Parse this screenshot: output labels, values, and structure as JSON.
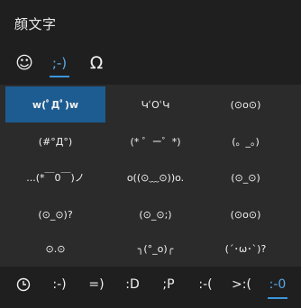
{
  "window": {
    "title": "顔文字"
  },
  "tabs": [
    {
      "label": "☺",
      "icon": "smiley-icon"
    },
    {
      "label": ";-)",
      "icon": "kaomoji"
    },
    {
      "label": "Ω",
      "icon": "omega-icon"
    }
  ],
  "grid": [
    [
      "w(ﾟДﾟ)w",
      "ԿՙOՙԿ",
      "(⊙o⊙)"
    ],
    [
      "(#°Д°)",
      "(* ゜ー゜*)",
      "(。_。)"
    ],
    [
      "...(*￣0￣)ノ",
      "o((⊙﹏⊙))o.",
      "(⊙_⊙)"
    ],
    [
      "(⊙_⊙)?",
      "(⊙_⊙;)",
      "(⊙o⊙)"
    ],
    [
      "⊙.⊙",
      "╮(°_o)╭",
      "(´･ω･`)?"
    ]
  ],
  "bottom_tabs": [
    {
      "label": "",
      "icon": "clock-icon"
    },
    {
      "label": ":-)"
    },
    {
      "label": "=)"
    },
    {
      "label": ":D"
    },
    {
      "label": ";P"
    },
    {
      "label": ":-("
    },
    {
      "label": ">:("
    },
    {
      "label": ":-0"
    }
  ],
  "colors": {
    "accent": "#3a96dd",
    "selected_cell": "#1d5c91",
    "background": "#1f1f1f",
    "grid_background": "#2b2b2b"
  }
}
